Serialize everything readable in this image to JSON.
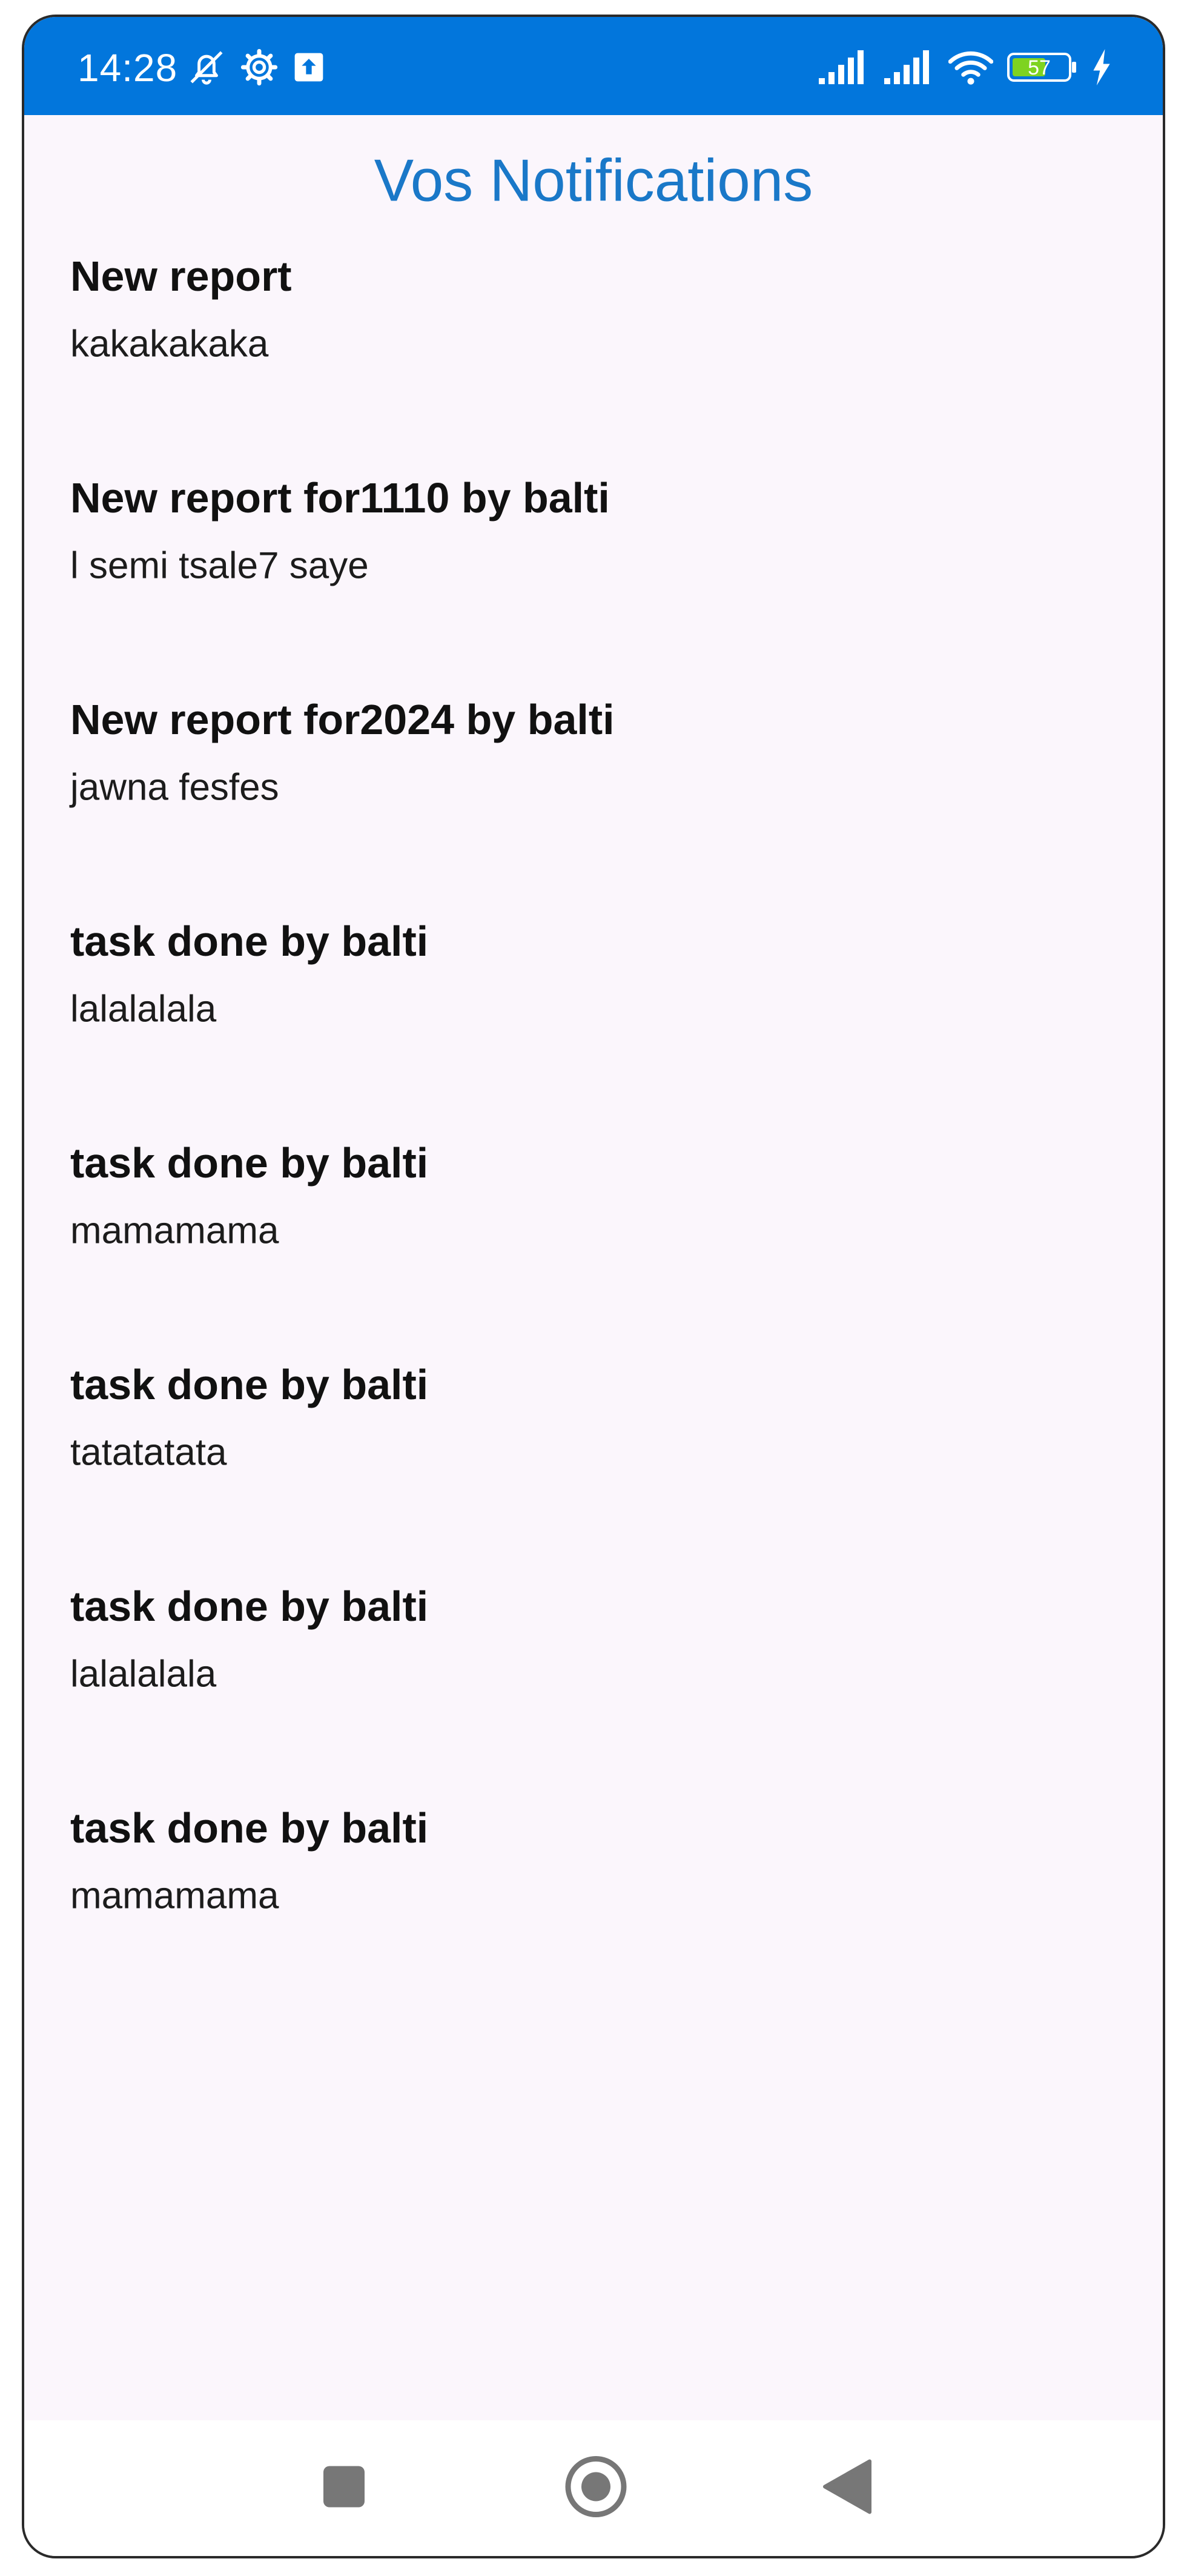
{
  "status_bar": {
    "time": "14:28",
    "battery_level": "57",
    "background_color": "#0276dc",
    "left_icons": [
      "bell-off-icon",
      "settings-icon",
      "upload-icon"
    ],
    "right_icons": [
      "signal-icon",
      "signal-icon",
      "wifi-icon",
      "battery-icon",
      "charging-icon"
    ]
  },
  "header": {
    "title": "Vos Notifications",
    "title_color": "#1a78c8"
  },
  "notifications": [
    {
      "title": "New report",
      "body": "kakakakaka"
    },
    {
      "title": "New report for1110 by balti",
      "body": "l semi tsale7 saye"
    },
    {
      "title": "New report for2024 by balti",
      "body": "jawna fesfes"
    },
    {
      "title": "task done by balti",
      "body": "lalalalala"
    },
    {
      "title": "task done by balti",
      "body": "mamamama"
    },
    {
      "title": "task done by balti",
      "body": "tatatatata"
    },
    {
      "title": "task done by balti",
      "body": "lalalalala"
    },
    {
      "title": "task done by balti",
      "body": "mamamama"
    }
  ],
  "nav_bar": {
    "buttons": [
      "recent-apps-icon",
      "home-icon",
      "back-icon"
    ]
  }
}
